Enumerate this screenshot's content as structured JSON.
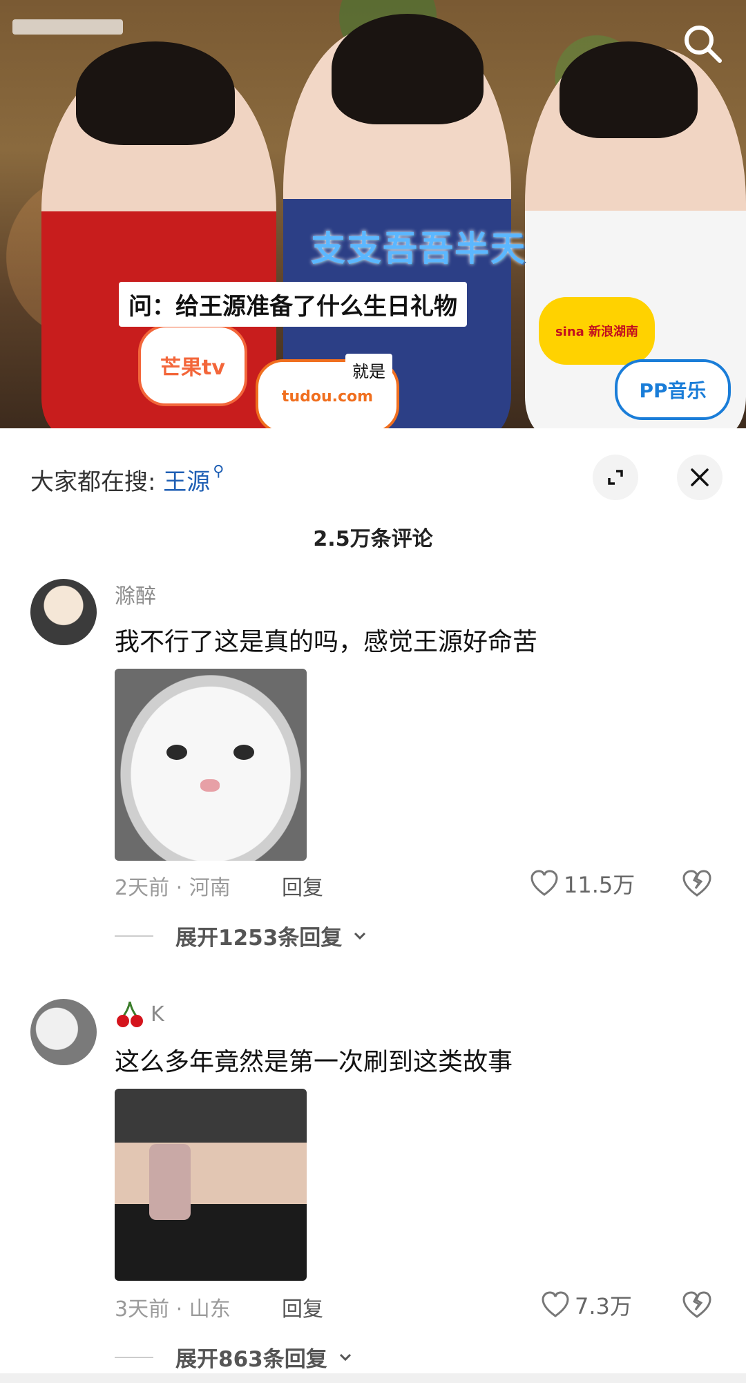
{
  "video": {
    "subtitle_top": "支支吾吾半天",
    "subtitle_question": "问：给王源准备了什么生日礼物",
    "subtitle_small": "就是",
    "mic_mango": "芒果tv",
    "mic_tudou": "tudou.com",
    "mic_sina": "sina 新浪湖南",
    "mic_pp": "PP音乐"
  },
  "search_hint": {
    "prefix": "大家都在搜: ",
    "keyword": "王源",
    "keyword_icon": "search-icon"
  },
  "comments_header": {
    "count_label": "2.5万条评论"
  },
  "comments": [
    {
      "username": "滁醉",
      "text": "我不行了这是真的吗，感觉王源好命苦",
      "meta": "2天前 · 河南",
      "reply_label": "回复",
      "likes": "11.5万",
      "expand_label": "展开1253条回复"
    },
    {
      "username_icon": "cherry-icon",
      "username": "K",
      "text": "这么多年竟然是第一次刷到这类故事",
      "meta": "3天前 · 山东",
      "reply_label": "回复",
      "likes": "7.3万",
      "expand_label": "展开863条回复"
    }
  ],
  "colors": {
    "accent_keyword": "#1f5fb4",
    "text_primary": "#111111",
    "text_secondary": "#9a9a9a"
  }
}
